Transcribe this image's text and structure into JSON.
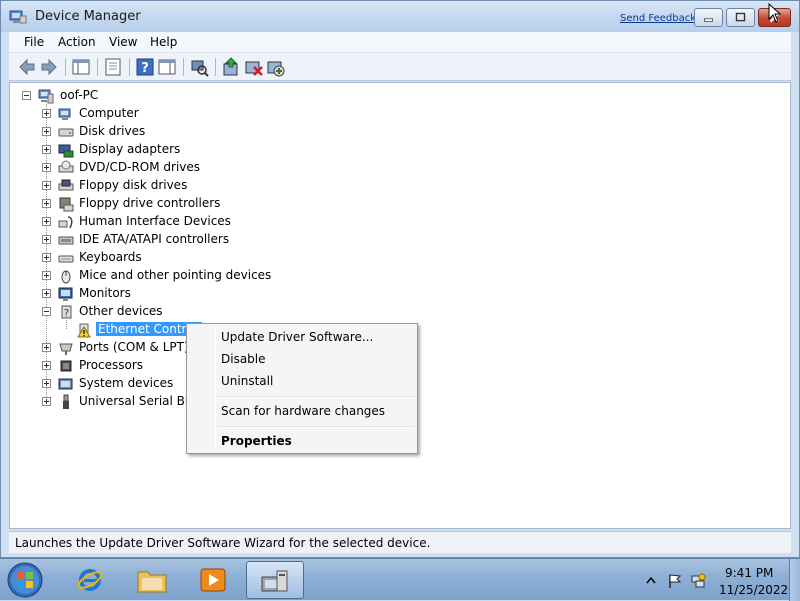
{
  "window": {
    "title": "Device Manager",
    "send_feedback": "Send Feedback"
  },
  "menubar": {
    "items": [
      "File",
      "Action",
      "View",
      "Help"
    ]
  },
  "toolbar": {
    "icons": [
      "back-arrow-icon",
      "forward-arrow-icon",
      "show-hide-console-tree-icon",
      "properties-sheet-icon",
      "help-icon",
      "action-pane-icon",
      "scan-hardware-icon",
      "update-driver-icon",
      "disable-device-icon",
      "uninstall-device-icon"
    ]
  },
  "tree": {
    "root": "oof-PC",
    "categories": [
      {
        "label": "Computer",
        "icon": "computer-icon",
        "expanded": false
      },
      {
        "label": "Disk drives",
        "icon": "disk-drive-icon",
        "expanded": false
      },
      {
        "label": "Display adapters",
        "icon": "display-adapter-icon",
        "expanded": false
      },
      {
        "label": "DVD/CD-ROM drives",
        "icon": "dvd-drive-icon",
        "expanded": false
      },
      {
        "label": "Floppy disk drives",
        "icon": "floppy-disk-icon",
        "expanded": false
      },
      {
        "label": "Floppy drive controllers",
        "icon": "floppy-controller-icon",
        "expanded": false
      },
      {
        "label": "Human Interface Devices",
        "icon": "hid-icon",
        "expanded": false
      },
      {
        "label": "IDE ATA/ATAPI controllers",
        "icon": "ide-controller-icon",
        "expanded": false
      },
      {
        "label": "Keyboards",
        "icon": "keyboard-icon",
        "expanded": false
      },
      {
        "label": "Mice and other pointing devices",
        "icon": "mouse-icon",
        "expanded": false
      },
      {
        "label": "Monitors",
        "icon": "monitor-icon",
        "expanded": false
      },
      {
        "label": "Other devices",
        "icon": "unknown-device-icon",
        "expanded": true
      },
      {
        "label": "Ports (COM & LPT)",
        "icon": "port-icon",
        "expanded": false
      },
      {
        "label": "Processors",
        "icon": "processor-icon",
        "expanded": false
      },
      {
        "label": "System devices",
        "icon": "system-device-icon",
        "expanded": false
      },
      {
        "label": "Universal Serial Bus c",
        "icon": "usb-icon",
        "expanded": false
      }
    ],
    "selected_child": "Ethernet Controll"
  },
  "context_menu": {
    "update_driver": "Update Driver Software...",
    "disable": "Disable",
    "uninstall": "Uninstall",
    "scan": "Scan for hardware changes",
    "properties": "Properties"
  },
  "status": {
    "text": "Launches the Update Driver Software Wizard for the selected device."
  },
  "taskbar": {
    "time": "9:41 PM",
    "date": "11/25/2022"
  },
  "colors": {
    "selection": "#3399ff",
    "titlebar": "#c4d8f0",
    "close_button": "#c24a33"
  }
}
